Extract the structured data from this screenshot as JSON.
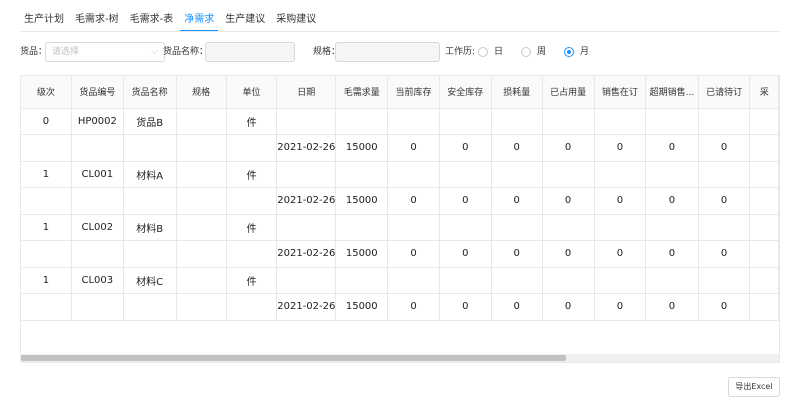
{
  "tabs": [
    {
      "label": "生产计划",
      "active": false
    },
    {
      "label": "毛需求-树",
      "active": false
    },
    {
      "label": "毛需求-表",
      "active": false
    },
    {
      "label": "净需求",
      "active": true
    },
    {
      "label": "生产建议",
      "active": false
    },
    {
      "label": "采购建议",
      "active": false
    }
  ],
  "filters": {
    "goods_label": "货品：",
    "goods_placeholder": "请选择",
    "goods_name_label": "货品名称：",
    "goods_name_value": "",
    "spec_label": "规格：",
    "spec_value": "",
    "calendar_label": "工作历:",
    "options": [
      {
        "label": "日",
        "selected": false
      },
      {
        "label": "周",
        "selected": false
      },
      {
        "label": "月",
        "selected": true
      }
    ]
  },
  "table": {
    "columns": [
      "级次",
      "货品编号",
      "货品名称",
      "规格",
      "单位",
      "日期",
      "毛需求量",
      "当前库存",
      "安全库存",
      "损耗量",
      "已占用量",
      "销售在订",
      "超期销售...",
      "已请待订",
      "采"
    ],
    "rows": [
      [
        "0",
        "HP0002",
        "货品B",
        "",
        "件",
        "",
        "",
        "",
        "",
        "",
        "",
        "",
        "",
        "",
        ""
      ],
      [
        "",
        "",
        "",
        "",
        "",
        "2021-02-26",
        "15000",
        "0",
        "0",
        "0",
        "0",
        "0",
        "0",
        "0",
        ""
      ],
      [
        "1",
        "CL001",
        "材料A",
        "",
        "件",
        "",
        "",
        "",
        "",
        "",
        "",
        "",
        "",
        "",
        ""
      ],
      [
        "",
        "",
        "",
        "",
        "",
        "2021-02-26",
        "15000",
        "0",
        "0",
        "0",
        "0",
        "0",
        "0",
        "0",
        ""
      ],
      [
        "1",
        "CL002",
        "材料B",
        "",
        "件",
        "",
        "",
        "",
        "",
        "",
        "",
        "",
        "",
        "",
        ""
      ],
      [
        "",
        "",
        "",
        "",
        "",
        "2021-02-26",
        "15000",
        "0",
        "0",
        "0",
        "0",
        "0",
        "0",
        "0",
        ""
      ],
      [
        "1",
        "CL003",
        "材料C",
        "",
        "件",
        "",
        "",
        "",
        "",
        "",
        "",
        "",
        "",
        "",
        ""
      ],
      [
        "",
        "",
        "",
        "",
        "",
        "2021-02-26",
        "15000",
        "0",
        "0",
        "0",
        "0",
        "0",
        "0",
        "0",
        ""
      ]
    ]
  },
  "export_label": "导出Excel",
  "colors": {
    "accent": "#1890ff",
    "border": "#e8e8e8",
    "header_bg": "#fafafa"
  }
}
